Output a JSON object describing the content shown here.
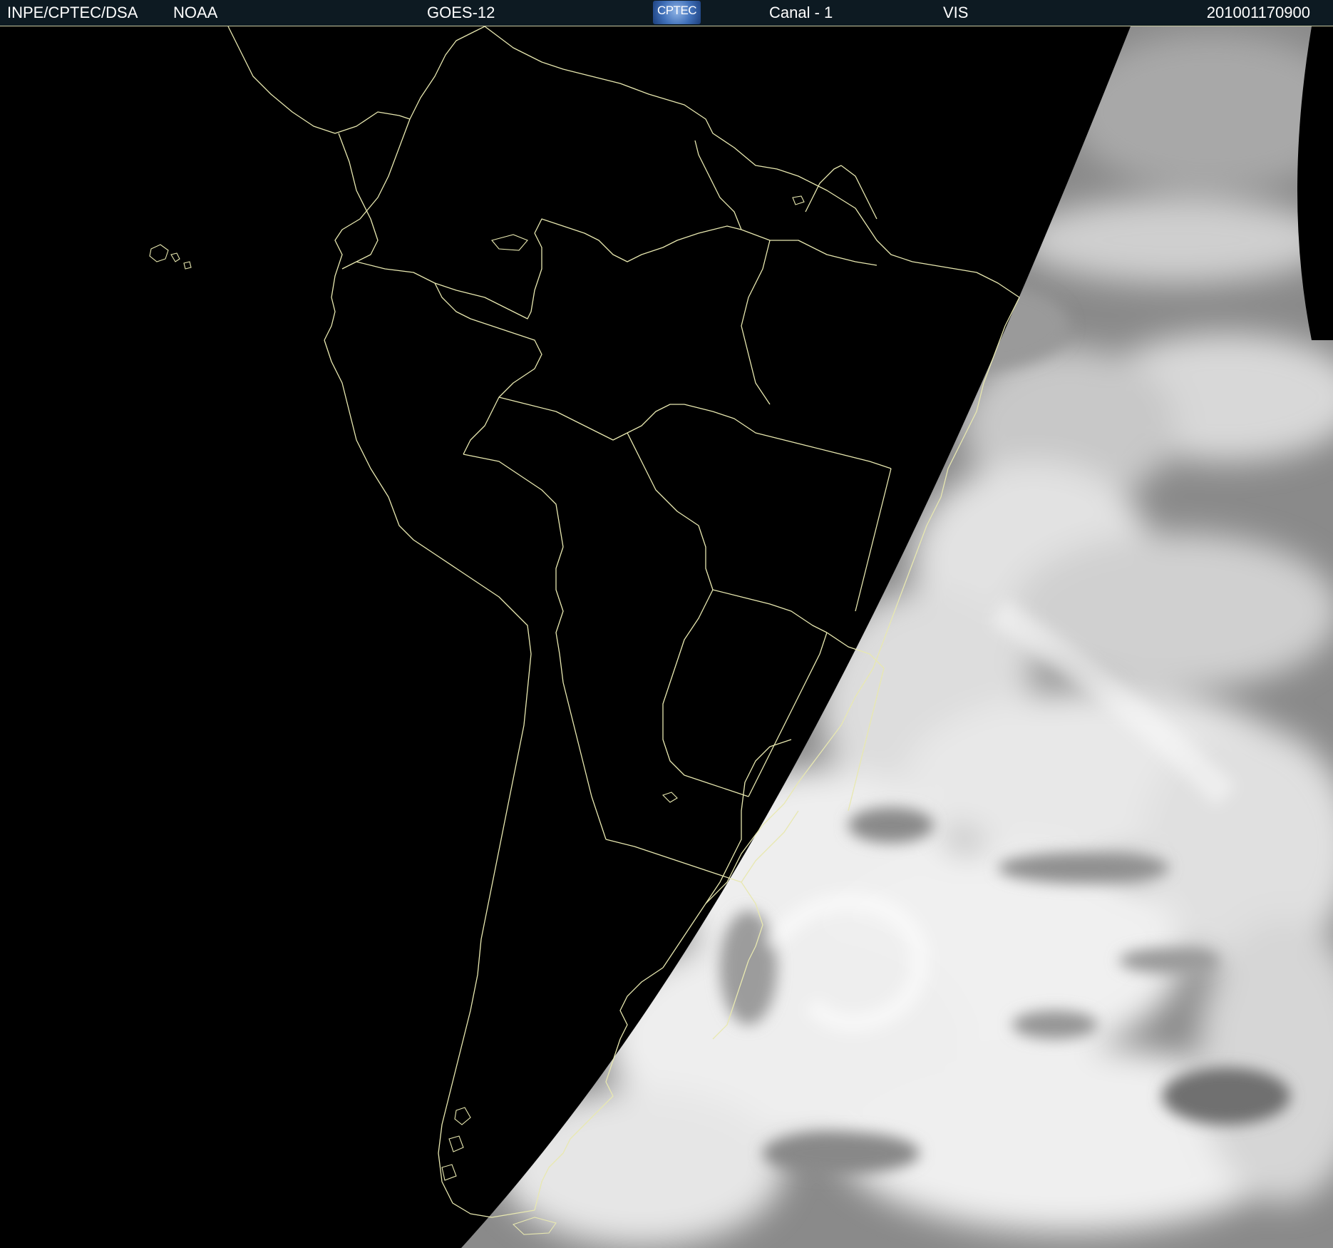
{
  "header": {
    "organization": "INPE/CPTEC/DSA",
    "agency": "NOAA",
    "satellite": "GOES-12",
    "logo_text": "CPTEC",
    "channel": "Canal - 1",
    "band": "VIS",
    "timestamp": "201001170900"
  },
  "map": {
    "region": "South America",
    "image_type": "visible satellite image",
    "colors": {
      "background": "#000000",
      "header_background": "#0d1a22",
      "header_text": "#ffffff",
      "outline": "#e8e8b0",
      "cloud_bright": "#eeeeee",
      "cloud_dark": "#7a7a7a"
    }
  }
}
